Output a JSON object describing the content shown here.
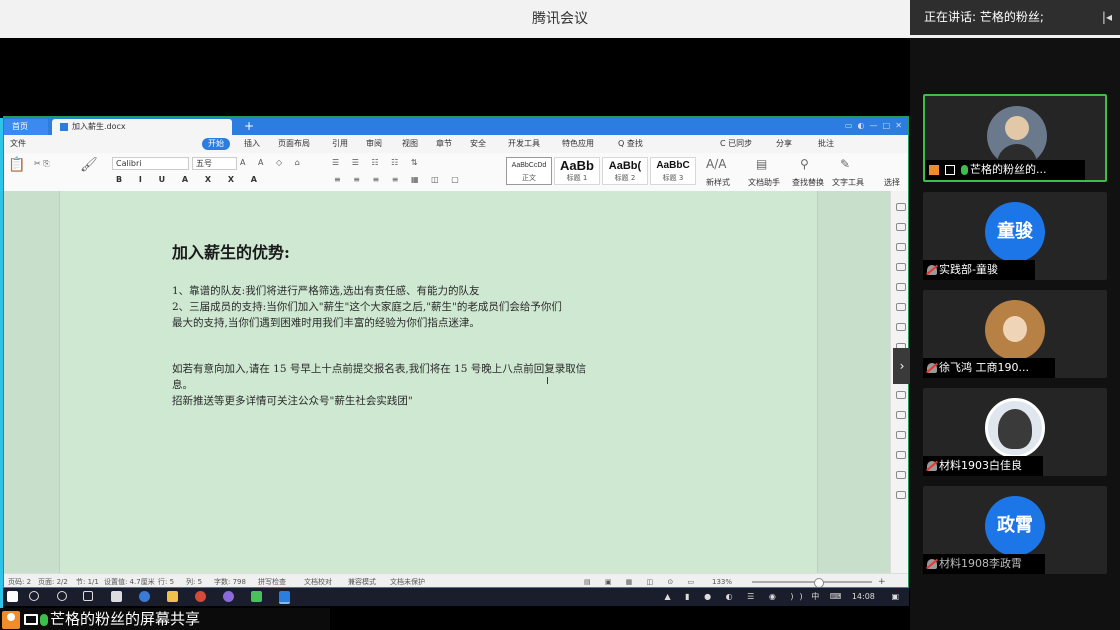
{
  "window": {
    "title": "腾讯会议"
  },
  "speaking": {
    "text": "正在讲话: 芒格的粉丝;"
  },
  "share": {
    "label": "芒格的粉丝的屏幕共享"
  },
  "wps": {
    "tabs": {
      "home": "首页",
      "document": "加入薪生.docx"
    },
    "menu": [
      "文件",
      "开始",
      "插入",
      "页面布局",
      "引用",
      "审阅",
      "视图",
      "章节",
      "安全",
      "开发工具",
      "特色应用",
      "Q 查找"
    ],
    "right_menu": [
      "C 已同步",
      "分享",
      "批注"
    ],
    "ribbon": {
      "font": "Calibri",
      "size": "五号",
      "styles": [
        {
          "sample": "AaBbCcDd",
          "label": "正文"
        },
        {
          "sample": "AaBb",
          "label": "标题 1"
        },
        {
          "sample": "AaBb(",
          "label": "标题 2"
        },
        {
          "sample": "AaBbC",
          "label": "标题 3"
        }
      ],
      "new_style": "新样式",
      "doc_helper": "文档助手",
      "find_replace": "查找替换",
      "text_tools": "文字工具",
      "select": "选择"
    },
    "document": {
      "heading": "加入薪生的优势:",
      "lines": [
        "1、靠谱的队友:我们将进行严格筛选,选出有责任感、有能力的队友",
        "2、三届成员的支持:当你们加入\"薪生\"这个大家庭之后,\"薪生\"的老成员们会给予你们",
        "最大的支持,当你们遇到困难时用我们丰富的经验为你们指点迷津。",
        "如若有意向加入,请在 15 号早上十点前提交报名表,我们将在 15 号晚上八点前回复录取信",
        "息。",
        "招新推送等更多详情可关注公众号\"薪生社会实践团\""
      ]
    },
    "status": {
      "page": "页码: 2",
      "pages": "页面: 2/2",
      "section": "节: 1/1",
      "setting": "设置值: 4.7厘米",
      "row": "行: 5",
      "col": "列: 5",
      "words": "字数: 798",
      "spell": "拼写检查",
      "proof": "文档校对",
      "compat": "兼容模式",
      "protect": "文档未保护",
      "zoom": "133%"
    },
    "taskbar": {
      "time": "14:08",
      "ime": "中"
    }
  },
  "participants": [
    {
      "name": "芒格的粉丝的...",
      "avatar_text": "",
      "avatar": "photo",
      "active": true
    },
    {
      "name": "实践部-童骏",
      "avatar_text": "童骏",
      "avatar": "blue",
      "active": false
    },
    {
      "name": "徐飞鸿 工商190...",
      "avatar_text": "",
      "avatar": "girl",
      "active": false
    },
    {
      "name": "材料1903白佳良",
      "avatar_text": "",
      "avatar": "anime",
      "active": false
    },
    {
      "name": "材料1908李政霄",
      "avatar_text": "政霄",
      "avatar": "blue",
      "active": false
    }
  ],
  "colors": {
    "accent_blue": "#2c7de0",
    "active_border": "#3bbf4a",
    "doc_background": "#cfe8d2",
    "avatar_blue": "#1d76e8"
  }
}
